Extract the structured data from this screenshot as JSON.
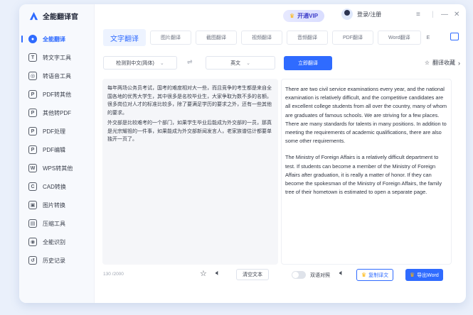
{
  "app": {
    "title": "全能翻译官"
  },
  "sidebar": {
    "items": [
      {
        "label": "全能翻译",
        "icon": "translate-icon",
        "glyph": "●"
      },
      {
        "label": "转文字工具",
        "icon": "text-icon",
        "glyph": "T"
      },
      {
        "label": "转语音工具",
        "icon": "voice-icon",
        "glyph": "◎"
      },
      {
        "label": "PDF转其他",
        "icon": "pdf-export-icon",
        "glyph": "P"
      },
      {
        "label": "其他转PDF",
        "icon": "pdf-import-icon",
        "glyph": "P"
      },
      {
        "label": "PDF处理",
        "icon": "pdf-process-icon",
        "glyph": "P"
      },
      {
        "label": "PDF编辑",
        "icon": "pdf-edit-icon",
        "glyph": "P"
      },
      {
        "label": "WPS转其他",
        "icon": "wps-icon",
        "glyph": "W"
      },
      {
        "label": "CAD转换",
        "icon": "cad-icon",
        "glyph": "C"
      },
      {
        "label": "图片转换",
        "icon": "image-icon",
        "glyph": "▣"
      },
      {
        "label": "压缩工具",
        "icon": "compress-icon",
        "glyph": "▤"
      },
      {
        "label": "全能识别",
        "icon": "scan-icon",
        "glyph": "◉"
      },
      {
        "label": "历史记录",
        "icon": "history-icon",
        "glyph": "↺"
      }
    ]
  },
  "header": {
    "vip_label": "开通VIP",
    "login_label": "登录/注册",
    "controls": {
      "menu": "≡",
      "minimize": "—",
      "close": "✕"
    }
  },
  "tabs": [
    {
      "label": "文字翻译"
    },
    {
      "label": "图片翻译"
    },
    {
      "label": "截图翻译"
    },
    {
      "label": "视频翻译"
    },
    {
      "label": "音频翻译"
    },
    {
      "label": "PDF翻译"
    },
    {
      "label": "Word翻译"
    },
    {
      "label": "E"
    }
  ],
  "controls": {
    "source_lang": "检测到中文(简体)",
    "target_lang": "英文",
    "swap_glyph": "⇌",
    "translate_label": "立即翻译",
    "favorites_label": "翻译收藏"
  },
  "source": {
    "paragraphs": [
      "每年两场公务员考试，国考的难度相对大一些，而且竞争的考生都是来自全国各地的优秀大学生，其中很多是名校毕业生，大家争取为数不多的名额。很多岗位对人才的标准比较多，除了要满足学历的要求之外，还有一些其他的要求。",
      "外交部是比较难考的一个部门，如果学生毕业后能成为外交部的一员，那真是光宗耀祖的一件事，如果能成为外交部新闻发言人，老家族谱估计都要单独开一页了。"
    ]
  },
  "target": {
    "paragraphs": [
      "There are two civil service examinations every year, and the national examination is relatively difficult, and the competitive candidates are all excellent college students from all over the country, many of whom are graduates of famous schools. We are striving for a few places. There are many standards for talents in many positions. In addition to meeting the requirements of academic qualifications, there are also some other requirements.",
      "The Ministry of Foreign Affairs is a relatively difficult department to test. If students can become a member of the Ministry of Foreign Affairs after graduation, it is really a matter of honor. If they can become the spokesman of the Ministry of Foreign Affairs, the family tree of their hometown is estimated to open a separate page."
    ]
  },
  "bottom": {
    "char_count": "130 /2000",
    "clear_label": "清空文本",
    "bilingual_label": "双语对照",
    "copy_label": "复制译文",
    "export_label": "导出Word"
  },
  "colors": {
    "accent": "#2f6bff",
    "vip": "#3c3cc8",
    "crown": "#ffb400"
  }
}
